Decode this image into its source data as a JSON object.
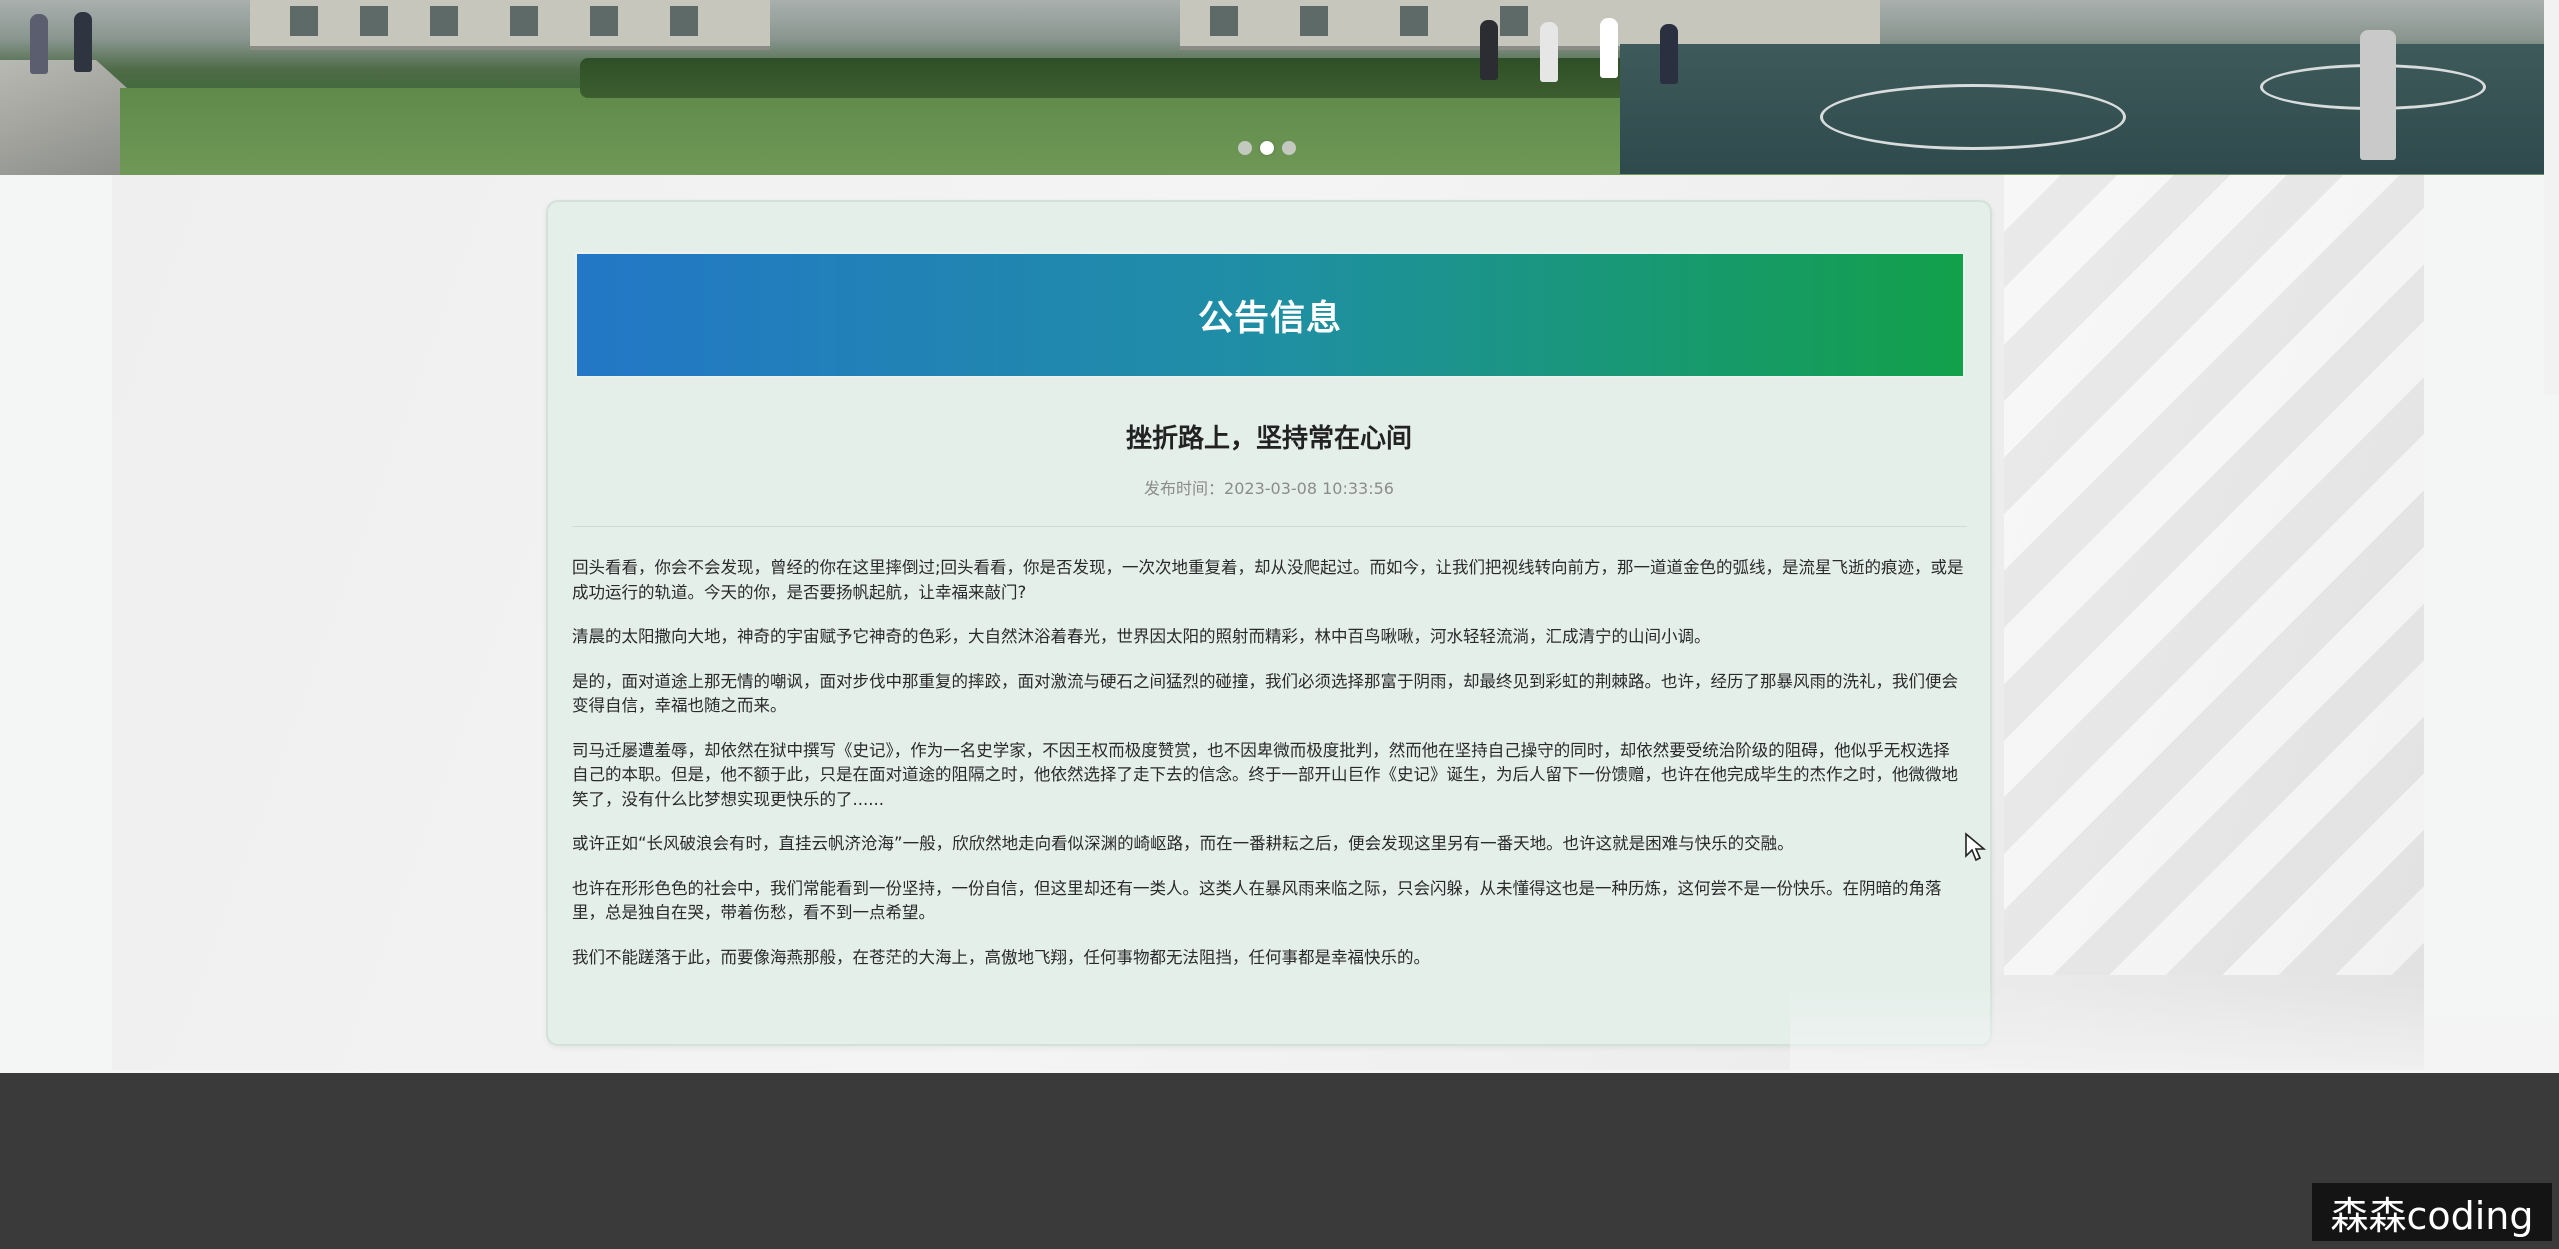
{
  "carousel": {
    "slide_count": 3,
    "active_index": 1
  },
  "notice": {
    "section_title": "公告信息",
    "article_title": "挫折路上，坚持常在心间",
    "publish_time": "发布时间：2023-03-08 10:33:56",
    "paragraphs": [
      "回头看看，你会不会发现，曾经的你在这里摔倒过;回头看看，你是否发现，一次次地重复着，却从没爬起过。而如今，让我们把视线转向前方，那一道道金色的弧线，是流星飞逝的痕迹，或是成功运行的轨道。今天的你，是否要扬帆起航，让幸福来敲门?",
      "清晨的太阳撒向大地，神奇的宇宙赋予它神奇的色彩，大自然沐浴着春光，世界因太阳的照射而精彩，林中百鸟啾啾，河水轻轻流淌，汇成清宁的山间小调。",
      "是的，面对道途上那无情的嘲讽，面对步伐中那重复的摔跤，面对激流与硬石之间猛烈的碰撞，我们必须选择那富于阴雨，却最终见到彩虹的荆棘路。也许，经历了那暴风雨的洗礼，我们便会变得自信，幸福也随之而来。",
      "司马迁屡遭羞辱，却依然在狱中撰写《史记》，作为一名史学家，不因王权而极度赞赏，也不因卑微而极度批判，然而他在坚持自己操守的同时，却依然要受统治阶级的阻碍，他似乎无权选择自己的本职。但是，他不额于此，只是在面对道途的阻隔之时，他依然选择了走下去的信念。终于一部开山巨作《史记》诞生，为后人留下一份馈赠，也许在他完成毕生的杰作之时，他微微地笑了，没有什么比梦想实现更快乐的了......",
      "或许正如“长风破浪会有时，直挂云帆济沧海”一般，欣欣然地走向看似深渊的崎岖路，而在一番耕耘之后，便会发现这里另有一番天地。也许这就是困难与快乐的交融。",
      "也许在形形色色的社会中，我们常能看到一份坚持，一份自信，但这里却还有一类人。这类人在暴风雨来临之际，只会闪躲，从未懂得这也是一种历炼，这何尝不是一份快乐。在阴暗的角落里，总是独自在哭，带着伤愁，看不到一点希望。",
      "我们不能蹉落于此，而要像海燕那般，在苍茫的大海上，高傲地飞翔，任何事物都无法阻挡，任何事都是幸福快乐的。"
    ]
  },
  "watermark": {
    "text": "森森coding"
  },
  "colors": {
    "banner_start": "#2377c6",
    "banner_end": "#12a04a",
    "card_bg": "#e4efea",
    "footer_bg": "#3a3a3a"
  }
}
